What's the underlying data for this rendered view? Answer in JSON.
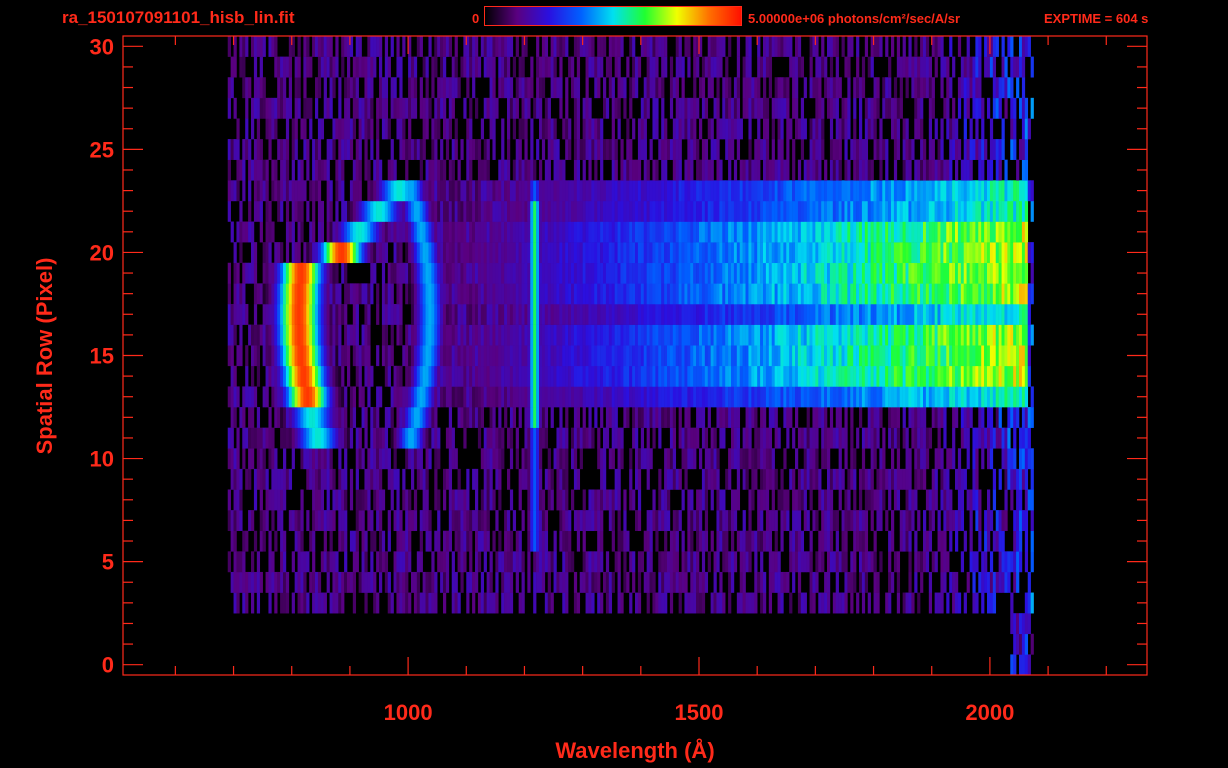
{
  "header": {
    "file_name": "ra_150107091101_hisb_lin.fit",
    "colorbar_min_label": "0",
    "colorbar_max_label": "5.00000e+06 photons/cm²/sec/A/sr",
    "exposure_label": "EXPTIME = 604 s"
  },
  "colors": {
    "axis": "#ff2a1a",
    "background": "#000000",
    "colormap": [
      "#000000",
      "#5a0080",
      "#2a10e0",
      "#0060ff",
      "#00e0f0",
      "#20ff30",
      "#f0ff00",
      "#ff7000",
      "#ff1000"
    ]
  },
  "chart_data": {
    "type": "heatmap",
    "title": "ra_150107091101_hisb_lin.fit",
    "xlabel": "Wavelength (Å)",
    "ylabel": "Spatial Row (Pixel)",
    "xlim": [
      510,
      2270
    ],
    "ylim": [
      -0.5,
      30.5
    ],
    "xticks": [
      1000,
      1500,
      2000
    ],
    "yticks": [
      0,
      5,
      10,
      15,
      20,
      25,
      30
    ],
    "colorbar": {
      "min": 0,
      "max": 5000000,
      "unit": "photons/cm²/sec/A/sr"
    },
    "emission_features": [
      {
        "wavelength": 810,
        "row_min": 13,
        "row_max": 20,
        "peak_intensity": 0.95
      },
      {
        "wavelength": 1035,
        "row_min": 11,
        "row_max": 23,
        "peak_intensity": 0.45
      },
      {
        "wavelength": 1215,
        "row_min": 6,
        "row_max": 23,
        "peak_intensity": 0.6
      }
    ],
    "continuum": {
      "wavelength_range": [
        1300,
        2060
      ],
      "row_min": 13,
      "row_max": 23,
      "intensity_range": [
        0.3,
        0.72
      ]
    },
    "detector_edge_wavelength": 2060,
    "exposure_time_s": 604
  }
}
